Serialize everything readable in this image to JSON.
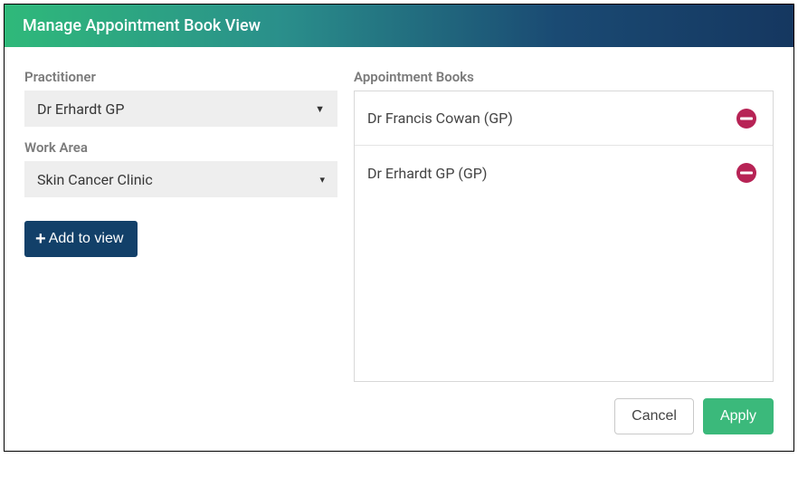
{
  "header": {
    "title": "Manage Appointment Book View"
  },
  "left": {
    "practitioner_label": "Practitioner",
    "practitioner_value": "Dr Erhardt GP",
    "workarea_label": "Work Area",
    "workarea_value": "Skin Cancer Clinic",
    "add_button": "Add to view"
  },
  "right": {
    "label": "Appointment Books",
    "books": [
      {
        "name": "Dr Francis Cowan (GP)"
      },
      {
        "name": "Dr Erhardt GP (GP)"
      }
    ]
  },
  "footer": {
    "cancel": "Cancel",
    "apply": "Apply"
  }
}
